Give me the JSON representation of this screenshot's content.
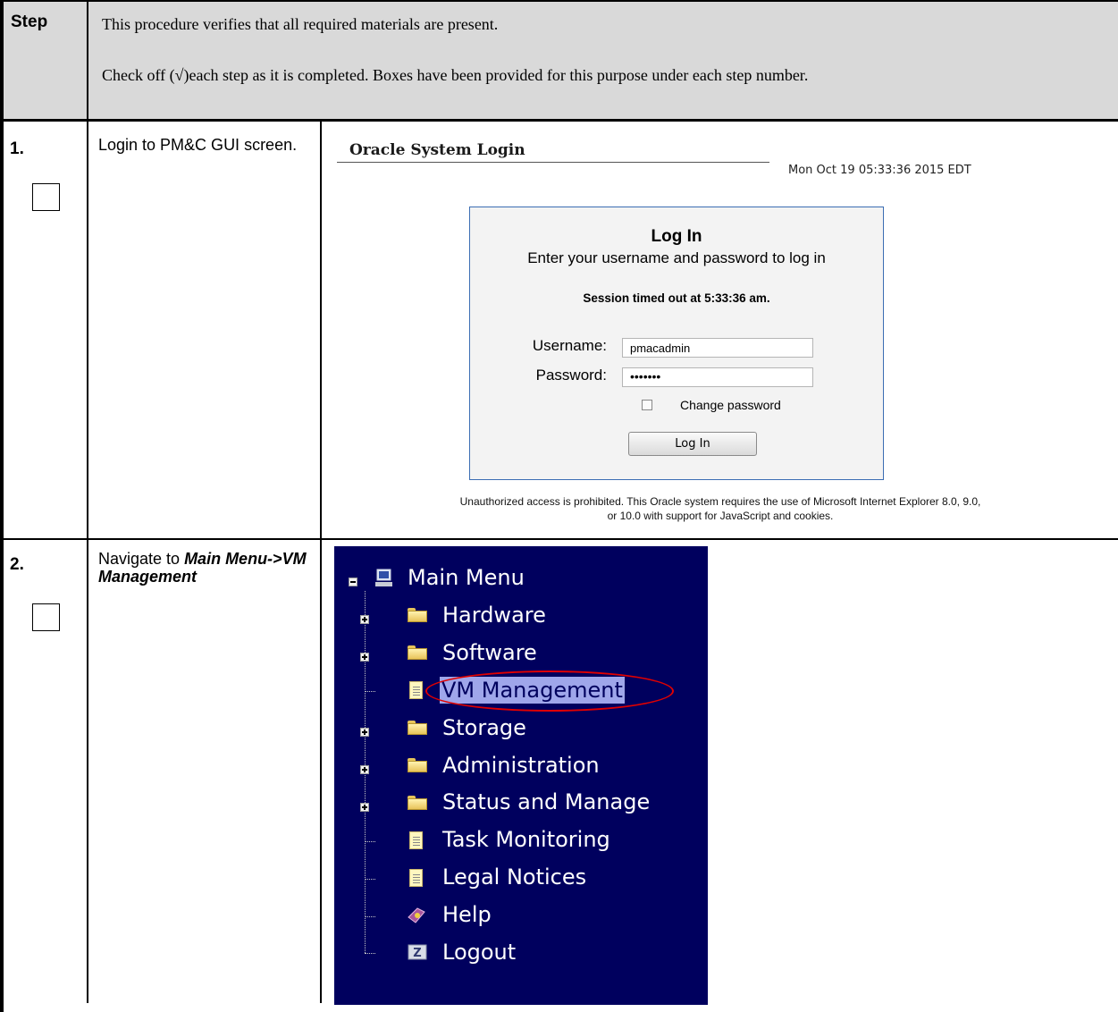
{
  "header": {
    "step_label": "Step",
    "intro_line1": "This procedure verifies that all required materials are present.",
    "intro_line2": "Check off (√)each step as it is completed. Boxes have been provided for this purpose under each step number."
  },
  "steps": [
    {
      "number": "1.",
      "text": "Login to PM&C GUI screen.",
      "login": {
        "title": "Oracle System Login",
        "datetime": "Mon Oct 19 05:33:36 2015 EDT",
        "box_title": "Log In",
        "box_subtitle": "Enter your username and password to log in",
        "message": "Session timed out at 5:33:36 am.",
        "username_label": "Username:",
        "username_value": "pmacadmin",
        "password_label": "Password:",
        "password_value": "•••••••",
        "change_password_label": "Change password",
        "button_label": "Log In",
        "footer_line1": "Unauthorized access is prohibited. This Oracle system requires the use of Microsoft Internet Explorer 8.0, 9.0,",
        "footer_line2": "or 10.0 with support for JavaScript and cookies."
      }
    },
    {
      "number": "2.",
      "text_prefix": "Navigate to ",
      "text_bold": "Main Menu->VM Management",
      "menu": {
        "root": "Main Menu",
        "items": [
          {
            "label": "Hardware",
            "icon": "folder-icon",
            "expandable": true
          },
          {
            "label": "Software",
            "icon": "folder-icon",
            "expandable": true
          },
          {
            "label": "VM Management",
            "icon": "page-icon",
            "expandable": false,
            "selected": true
          },
          {
            "label": "Storage",
            "icon": "folder-icon",
            "expandable": true
          },
          {
            "label": "Administration",
            "icon": "folder-icon",
            "expandable": true
          },
          {
            "label": "Status and Manage",
            "icon": "folder-icon",
            "expandable": true
          },
          {
            "label": "Task Monitoring",
            "icon": "page-icon",
            "expandable": false
          },
          {
            "label": "Legal Notices",
            "icon": "page-icon",
            "expandable": false
          },
          {
            "label": "Help",
            "icon": "help-icon",
            "expandable": false
          },
          {
            "label": "Logout",
            "icon": "logout-icon",
            "expandable": false
          }
        ]
      }
    }
  ],
  "colors": {
    "header_bg": "#d9d9d9",
    "menu_bg": "#00005e",
    "highlight_ring": "#e00000",
    "login_border": "#3b6db3"
  }
}
